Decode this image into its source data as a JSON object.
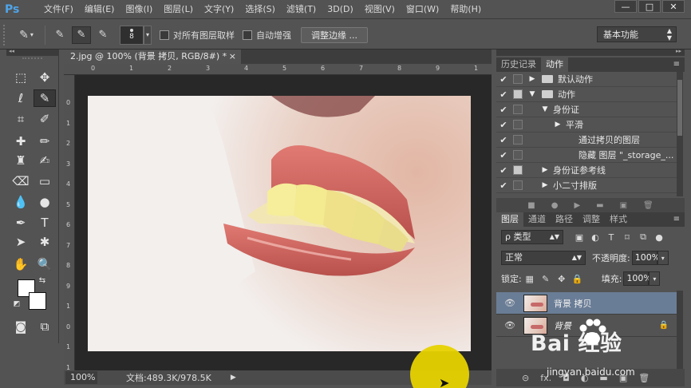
{
  "app": {
    "logo": "Ps"
  },
  "menu": [
    "文件(F)",
    "编辑(E)",
    "图像(I)",
    "图层(L)",
    "文字(Y)",
    "选择(S)",
    "滤镜(T)",
    "3D(D)",
    "视图(V)",
    "窗口(W)",
    "帮助(H)"
  ],
  "window_buttons": {
    "minimize": "—",
    "maximize": "□",
    "close": "✕"
  },
  "options": {
    "brush_size": "8",
    "sample_all_layers": "对所有图层取样",
    "auto_enhance": "自动增强",
    "refine_edge": "调整边缘 ...",
    "workspace": "基本功能"
  },
  "document": {
    "tab_title": "2.jpg @ 100% (背景 拷贝, RGB/8#) *",
    "close": "×",
    "ruler_top": [
      "0",
      "1",
      "2",
      "3",
      "4",
      "5",
      "6",
      "7",
      "8",
      "9",
      "1"
    ],
    "ruler_left": [
      "0",
      "1",
      "2",
      "3",
      "4",
      "5",
      "6",
      "7",
      "8",
      "9",
      "1",
      "0",
      "1",
      "1"
    ],
    "zoom": "100%",
    "doc_size": "文档:489.3K/978.5K"
  },
  "panels": {
    "top_tabs": [
      "历史记录",
      "动作"
    ],
    "actions": [
      {
        "label": "默认动作",
        "checked": true,
        "box": false,
        "expanded": false,
        "folder": true,
        "indent": 0
      },
      {
        "label": "动作",
        "checked": true,
        "box": true,
        "expanded": true,
        "folder": true,
        "indent": 0
      },
      {
        "label": "身份证",
        "checked": true,
        "box": false,
        "expanded": true,
        "folder": false,
        "indent": 1
      },
      {
        "label": "平滑",
        "checked": true,
        "box": false,
        "expanded": false,
        "folder": false,
        "indent": 2
      },
      {
        "label": "通过拷贝的图层",
        "checked": true,
        "box": false,
        "expanded": null,
        "folder": false,
        "indent": 3
      },
      {
        "label": "隐藏 图层 \"_storage_...",
        "checked": true,
        "box": false,
        "expanded": null,
        "folder": false,
        "indent": 3
      },
      {
        "label": "身份证参考线",
        "checked": true,
        "box": true,
        "expanded": false,
        "folder": false,
        "indent": 1
      },
      {
        "label": "小二寸排版",
        "checked": true,
        "box": false,
        "expanded": false,
        "folder": false,
        "indent": 1
      }
    ],
    "layer_tabs": [
      "图层",
      "通道",
      "路径",
      "调整",
      "样式"
    ],
    "filter_kind": "ρ 类型",
    "blend_mode": "正常",
    "opacity_label": "不透明度:",
    "opacity_value": "100%",
    "lock_label": "锁定:",
    "fill_label": "填充:",
    "fill_value": "100%",
    "layers": [
      {
        "name": "背景 拷贝",
        "selected": true,
        "italic": false,
        "locked": false
      },
      {
        "name": "背景",
        "selected": false,
        "italic": true,
        "locked": true
      }
    ],
    "footer_icons": [
      "⊝",
      "fx.",
      "◘",
      "◐",
      "▬",
      "▣",
      "🗑"
    ]
  },
  "watermark": {
    "text": "Bai 经验",
    "sub": "jingyan.baidu.com"
  },
  "colors": {
    "accent": "#4fa4e8",
    "selected_layer": "#6a7d96",
    "spotlight": "#e6d200"
  }
}
